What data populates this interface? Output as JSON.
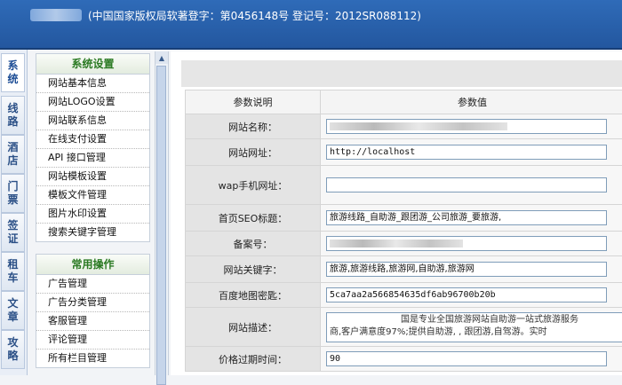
{
  "header": {
    "copyright_text": "(中国国家版权局软著登字：第0456148号 登记号：2012SR088112)"
  },
  "vertical_tabs": [
    {
      "label": "系统"
    },
    {
      "label": "线路"
    },
    {
      "label": "酒店"
    },
    {
      "label": "门票"
    },
    {
      "label": "签证"
    },
    {
      "label": "租车"
    },
    {
      "label": "文章"
    },
    {
      "label": "攻略"
    }
  ],
  "sidebar": {
    "system_settings": {
      "title": "系统设置",
      "items": [
        {
          "label": "网站基本信息"
        },
        {
          "label": "网站LOGO设置"
        },
        {
          "label": "网站联系信息"
        },
        {
          "label": "在线支付设置"
        },
        {
          "label": "API 接口管理"
        },
        {
          "label": "网站模板设置"
        },
        {
          "label": "模板文件管理"
        },
        {
          "label": "图片水印设置"
        },
        {
          "label": "搜索关键字管理"
        }
      ]
    },
    "common_ops": {
      "title": "常用操作",
      "items": [
        {
          "label": "广告管理"
        },
        {
          "label": "广告分类管理"
        },
        {
          "label": "客服管理"
        },
        {
          "label": "评论管理"
        },
        {
          "label": "所有栏目管理"
        }
      ]
    }
  },
  "form": {
    "header_param": "参数说明",
    "header_value": "参数值",
    "rows": {
      "site_name": {
        "label": "网站名称："
      },
      "site_url": {
        "label": "网站网址：",
        "value": "http://localhost"
      },
      "wap_url": {
        "label": "wap手机网址：",
        "value": ""
      },
      "seo_title": {
        "label": "首页SEO标题：",
        "value": "旅游线路_自助游_跟团游_公司旅游_要旅游,"
      },
      "icp": {
        "label": "备案号："
      },
      "keywords": {
        "label": "网站关键字：",
        "value": "旅游,旅游线路,旅游网,自助游,旅游网"
      },
      "map_key": {
        "label": "百度地图密匙：",
        "value": "5ca7aa2a566854635df6ab96700b20b"
      },
      "description": {
        "label": "网站描述：",
        "line1": "国是专业全国旅游网站自助游一站式旅游服务",
        "line2": "商,客户满意度97%;提供自助游,  ,  跟团游,自驾游。实时"
      },
      "price_expire": {
        "label": "价格过期时间：",
        "value": "90"
      }
    }
  }
}
